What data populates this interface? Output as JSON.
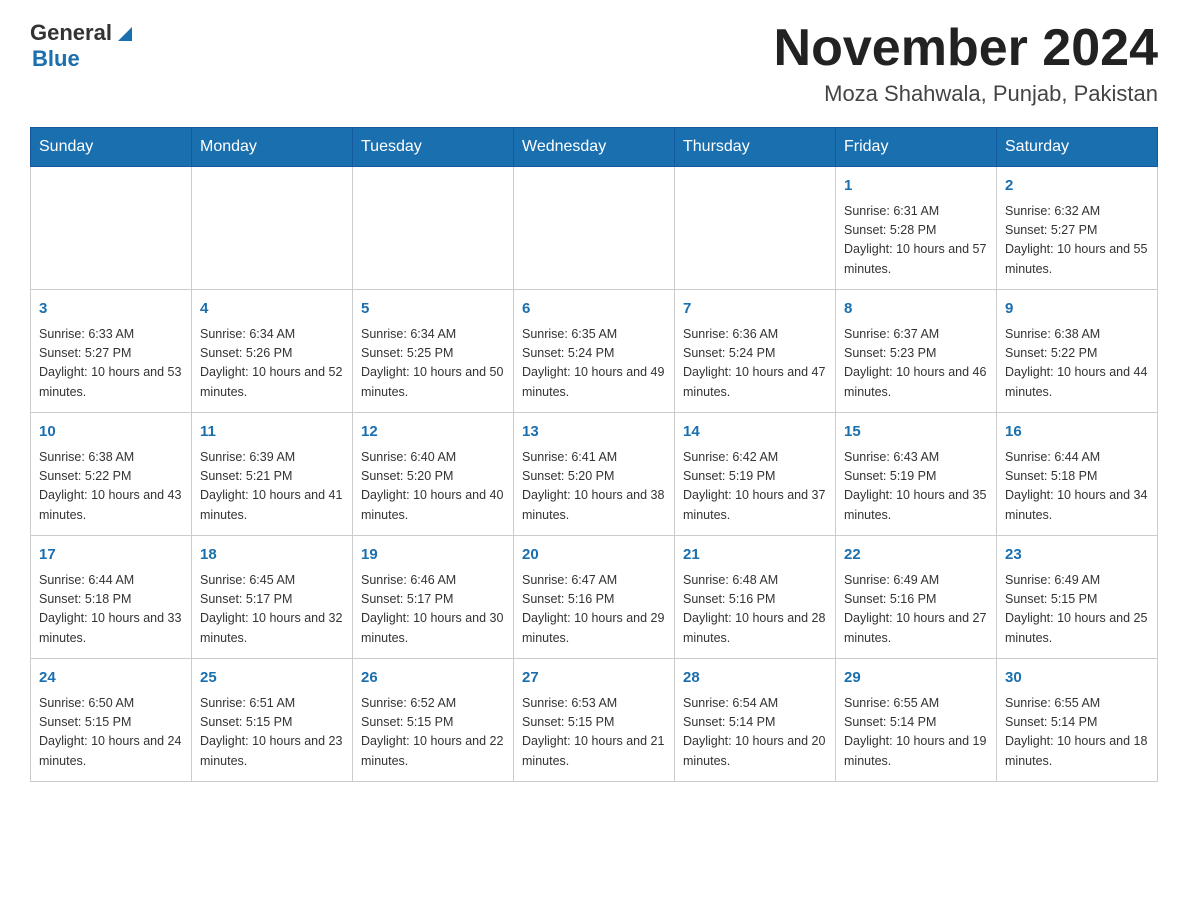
{
  "header": {
    "logo": {
      "general": "General",
      "triangle": "▶",
      "blue": "Blue"
    },
    "title": "November 2024",
    "location": "Moza Shahwala, Punjab, Pakistan"
  },
  "weekdays": [
    "Sunday",
    "Monday",
    "Tuesday",
    "Wednesday",
    "Thursday",
    "Friday",
    "Saturday"
  ],
  "weeks": [
    [
      {
        "day": "",
        "info": ""
      },
      {
        "day": "",
        "info": ""
      },
      {
        "day": "",
        "info": ""
      },
      {
        "day": "",
        "info": ""
      },
      {
        "day": "",
        "info": ""
      },
      {
        "day": "1",
        "info": "Sunrise: 6:31 AM\nSunset: 5:28 PM\nDaylight: 10 hours and 57 minutes."
      },
      {
        "day": "2",
        "info": "Sunrise: 6:32 AM\nSunset: 5:27 PM\nDaylight: 10 hours and 55 minutes."
      }
    ],
    [
      {
        "day": "3",
        "info": "Sunrise: 6:33 AM\nSunset: 5:27 PM\nDaylight: 10 hours and 53 minutes."
      },
      {
        "day": "4",
        "info": "Sunrise: 6:34 AM\nSunset: 5:26 PM\nDaylight: 10 hours and 52 minutes."
      },
      {
        "day": "5",
        "info": "Sunrise: 6:34 AM\nSunset: 5:25 PM\nDaylight: 10 hours and 50 minutes."
      },
      {
        "day": "6",
        "info": "Sunrise: 6:35 AM\nSunset: 5:24 PM\nDaylight: 10 hours and 49 minutes."
      },
      {
        "day": "7",
        "info": "Sunrise: 6:36 AM\nSunset: 5:24 PM\nDaylight: 10 hours and 47 minutes."
      },
      {
        "day": "8",
        "info": "Sunrise: 6:37 AM\nSunset: 5:23 PM\nDaylight: 10 hours and 46 minutes."
      },
      {
        "day": "9",
        "info": "Sunrise: 6:38 AM\nSunset: 5:22 PM\nDaylight: 10 hours and 44 minutes."
      }
    ],
    [
      {
        "day": "10",
        "info": "Sunrise: 6:38 AM\nSunset: 5:22 PM\nDaylight: 10 hours and 43 minutes."
      },
      {
        "day": "11",
        "info": "Sunrise: 6:39 AM\nSunset: 5:21 PM\nDaylight: 10 hours and 41 minutes."
      },
      {
        "day": "12",
        "info": "Sunrise: 6:40 AM\nSunset: 5:20 PM\nDaylight: 10 hours and 40 minutes."
      },
      {
        "day": "13",
        "info": "Sunrise: 6:41 AM\nSunset: 5:20 PM\nDaylight: 10 hours and 38 minutes."
      },
      {
        "day": "14",
        "info": "Sunrise: 6:42 AM\nSunset: 5:19 PM\nDaylight: 10 hours and 37 minutes."
      },
      {
        "day": "15",
        "info": "Sunrise: 6:43 AM\nSunset: 5:19 PM\nDaylight: 10 hours and 35 minutes."
      },
      {
        "day": "16",
        "info": "Sunrise: 6:44 AM\nSunset: 5:18 PM\nDaylight: 10 hours and 34 minutes."
      }
    ],
    [
      {
        "day": "17",
        "info": "Sunrise: 6:44 AM\nSunset: 5:18 PM\nDaylight: 10 hours and 33 minutes."
      },
      {
        "day": "18",
        "info": "Sunrise: 6:45 AM\nSunset: 5:17 PM\nDaylight: 10 hours and 32 minutes."
      },
      {
        "day": "19",
        "info": "Sunrise: 6:46 AM\nSunset: 5:17 PM\nDaylight: 10 hours and 30 minutes."
      },
      {
        "day": "20",
        "info": "Sunrise: 6:47 AM\nSunset: 5:16 PM\nDaylight: 10 hours and 29 minutes."
      },
      {
        "day": "21",
        "info": "Sunrise: 6:48 AM\nSunset: 5:16 PM\nDaylight: 10 hours and 28 minutes."
      },
      {
        "day": "22",
        "info": "Sunrise: 6:49 AM\nSunset: 5:16 PM\nDaylight: 10 hours and 27 minutes."
      },
      {
        "day": "23",
        "info": "Sunrise: 6:49 AM\nSunset: 5:15 PM\nDaylight: 10 hours and 25 minutes."
      }
    ],
    [
      {
        "day": "24",
        "info": "Sunrise: 6:50 AM\nSunset: 5:15 PM\nDaylight: 10 hours and 24 minutes."
      },
      {
        "day": "25",
        "info": "Sunrise: 6:51 AM\nSunset: 5:15 PM\nDaylight: 10 hours and 23 minutes."
      },
      {
        "day": "26",
        "info": "Sunrise: 6:52 AM\nSunset: 5:15 PM\nDaylight: 10 hours and 22 minutes."
      },
      {
        "day": "27",
        "info": "Sunrise: 6:53 AM\nSunset: 5:15 PM\nDaylight: 10 hours and 21 minutes."
      },
      {
        "day": "28",
        "info": "Sunrise: 6:54 AM\nSunset: 5:14 PM\nDaylight: 10 hours and 20 minutes."
      },
      {
        "day": "29",
        "info": "Sunrise: 6:55 AM\nSunset: 5:14 PM\nDaylight: 10 hours and 19 minutes."
      },
      {
        "day": "30",
        "info": "Sunrise: 6:55 AM\nSunset: 5:14 PM\nDaylight: 10 hours and 18 minutes."
      }
    ]
  ]
}
